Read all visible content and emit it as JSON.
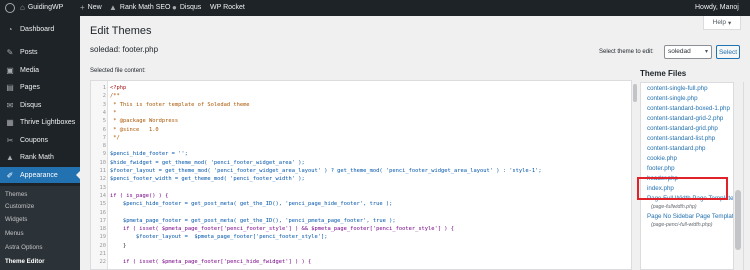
{
  "adminbar": {
    "site_name": "GuidingWP",
    "new_label": "New",
    "rank_math_label": "Rank Math SEO",
    "disqus_label": "Disqus",
    "wp_rocket_label": "WP Rocket",
    "howdy": "Howdy, Manoj"
  },
  "sidebar": {
    "items": [
      {
        "label": "Dashboard",
        "icon": "dashboard-icon",
        "glyph": "◔"
      },
      {
        "label": "Posts",
        "icon": "pushpin-icon",
        "glyph": "✎"
      },
      {
        "label": "Media",
        "icon": "media-icon",
        "glyph": "▣"
      },
      {
        "label": "Pages",
        "icon": "pages-icon",
        "glyph": "▤"
      },
      {
        "label": "Disqus",
        "icon": "disqus-icon",
        "glyph": "✉"
      },
      {
        "label": "Thrive Lightboxes",
        "icon": "lightbox-icon",
        "glyph": "▦"
      },
      {
        "label": "Coupons",
        "icon": "coupon-icon",
        "glyph": "✂"
      },
      {
        "label": "Rank Math",
        "icon": "rank-math-icon",
        "glyph": "▲"
      },
      {
        "label": "Appearance",
        "icon": "paintbrush-icon",
        "glyph": "✐"
      }
    ],
    "submenu": [
      "Themes",
      "Customize",
      "Widgets",
      "Menus",
      "Astra Options",
      "Theme Editor"
    ]
  },
  "help_label": "Help",
  "page_title": "Edit Themes",
  "file_title": "soledad: footer.php",
  "select_theme_label": "Select theme to edit:",
  "selected_theme": "soledad",
  "select_button": "Select",
  "selected_file_label": "Selected file content:",
  "code_lines": [
    {
      "n": "1",
      "t": "<?php",
      "c": "c-tag"
    },
    {
      "n": "2",
      "t": "/**",
      "c": "c-com"
    },
    {
      "n": "3",
      "t": " * This is footer template of Soledad theme",
      "c": "c-com"
    },
    {
      "n": "4",
      "t": " *",
      "c": "c-com"
    },
    {
      "n": "5",
      "t": " * @package Wordpress",
      "c": "c-com"
    },
    {
      "n": "6",
      "t": " * @since   1.0",
      "c": "c-com"
    },
    {
      "n": "7",
      "t": " */",
      "c": "c-com"
    },
    {
      "n": "8",
      "t": "",
      "c": "c-def"
    },
    {
      "n": "9",
      "t": "$penci_hide_footer = '';",
      "c": "c-var"
    },
    {
      "n": "10",
      "t": "$hide_fwidget = get_theme_mod( 'penci_footer_widget_area' );",
      "c": "c-var"
    },
    {
      "n": "11",
      "t": "$footer_layout = get_theme_mod( 'penci_footer_widget_area_layout' ) ? get_theme_mod( 'penci_footer_widget_area_layout' ) : 'style-1';",
      "c": "c-var"
    },
    {
      "n": "12",
      "t": "$penci_footer_width = get_theme_mod( 'penci_footer_width' );",
      "c": "c-var"
    },
    {
      "n": "13",
      "t": "",
      "c": "c-def"
    },
    {
      "n": "14",
      "t": "if ( is_page() ) {",
      "c": "c-key"
    },
    {
      "n": "15",
      "t": "    $penci_hide_footer = get_post_meta( get_the_ID(), 'penci_page_hide_footer', true );",
      "c": "c-var"
    },
    {
      "n": "16",
      "t": "",
      "c": "c-def"
    },
    {
      "n": "17",
      "t": "    $pmeta_page_footer = get_post_meta( get_the_ID(), 'penci_pmeta_page_footer', true );",
      "c": "c-var"
    },
    {
      "n": "18",
      "t": "    if ( isset( $pmeta_page_footer['penci_footer_style'] ) && $pmeta_page_footer['penci_footer_style'] ) {",
      "c": "c-key"
    },
    {
      "n": "19",
      "t": "        $footer_layout =  $pmeta_page_footer['penci_footer_style'];",
      "c": "c-var"
    },
    {
      "n": "20",
      "t": "    }",
      "c": "c-def"
    },
    {
      "n": "21",
      "t": "",
      "c": "c-def"
    },
    {
      "n": "22",
      "t": "    if ( isset( $pmeta_page_footer['penci_hide_fwidget'] ) ) {",
      "c": "c-key"
    }
  ],
  "theme_files_title": "Theme Files",
  "theme_files": [
    {
      "label": "content-single-full.php"
    },
    {
      "label": "content-single.php"
    },
    {
      "label": "content-standard-boxed-1.php"
    },
    {
      "label": "content-standard-grid-2.php"
    },
    {
      "label": "content-standard-grid.php"
    },
    {
      "label": "content-standard-list.php"
    },
    {
      "label": "content-standard.php"
    },
    {
      "label": "cookie.php"
    },
    {
      "label": "footer.php"
    },
    {
      "label": "header.php"
    },
    {
      "label": "index.php"
    },
    {
      "label": "Page Full Width Page Template",
      "desc": "(page-fullwidth.php)"
    },
    {
      "label": "Page No Sidebar Page Template",
      "desc": "(page-penci-full-width.php)"
    }
  ]
}
